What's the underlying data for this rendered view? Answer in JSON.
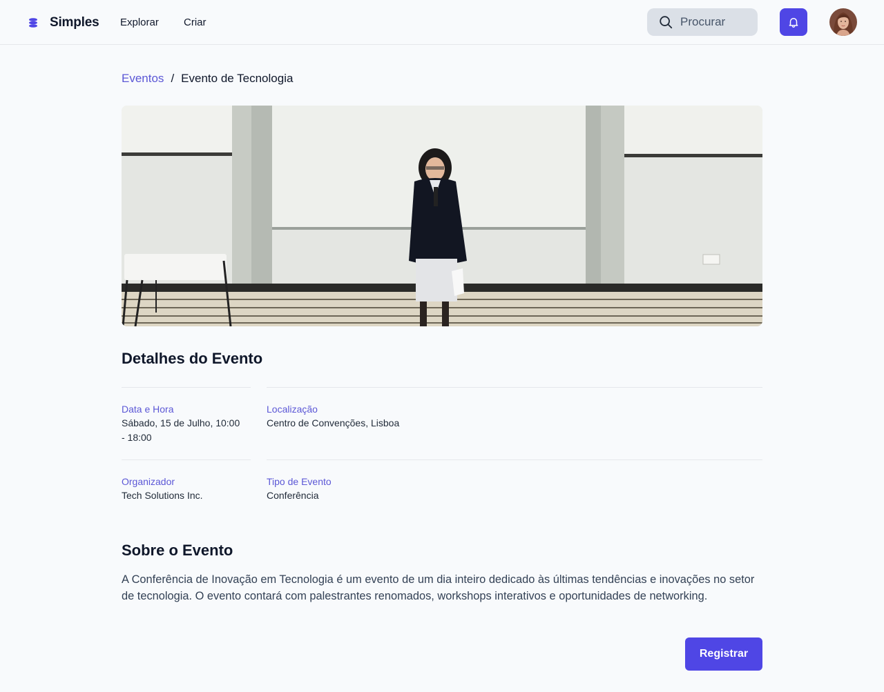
{
  "header": {
    "brand_name": "Simples",
    "nav": {
      "explore_label": "Explorar",
      "create_label": "Criar"
    },
    "search": {
      "placeholder": "Procurar"
    }
  },
  "breadcrumb": {
    "parent": "Eventos",
    "separator": "/",
    "current": "Evento de Tecnologia"
  },
  "details": {
    "title": "Detalhes do Evento",
    "datetime": {
      "label": "Data e Hora",
      "value_line1": "Sábado, 15 de Julho, 10:00",
      "value_line2": "- 18:00"
    },
    "location": {
      "label": "Localização",
      "value": "Centro de Convenções, Lisboa"
    },
    "organizer": {
      "label": "Organizador",
      "value": "Tech Solutions Inc."
    },
    "type": {
      "label": "Tipo de Evento",
      "value": "Conferência"
    }
  },
  "about": {
    "title": "Sobre o Evento",
    "text": "A Conferência de Inovação em Tecnologia é um evento de um dia inteiro dedicado às últimas tendências e inovações no setor de tecnologia. O evento contará com palestrantes renomados, workshops interativos e oportunidades de networking."
  },
  "actions": {
    "register_label": "Registrar"
  },
  "icons": {
    "logo": "stack-logo-icon",
    "search": "search-icon",
    "notifications": "bell-icon"
  },
  "colors": {
    "accent": "#4f46e5",
    "link": "#5b57d6",
    "background": "#f8fafc"
  }
}
